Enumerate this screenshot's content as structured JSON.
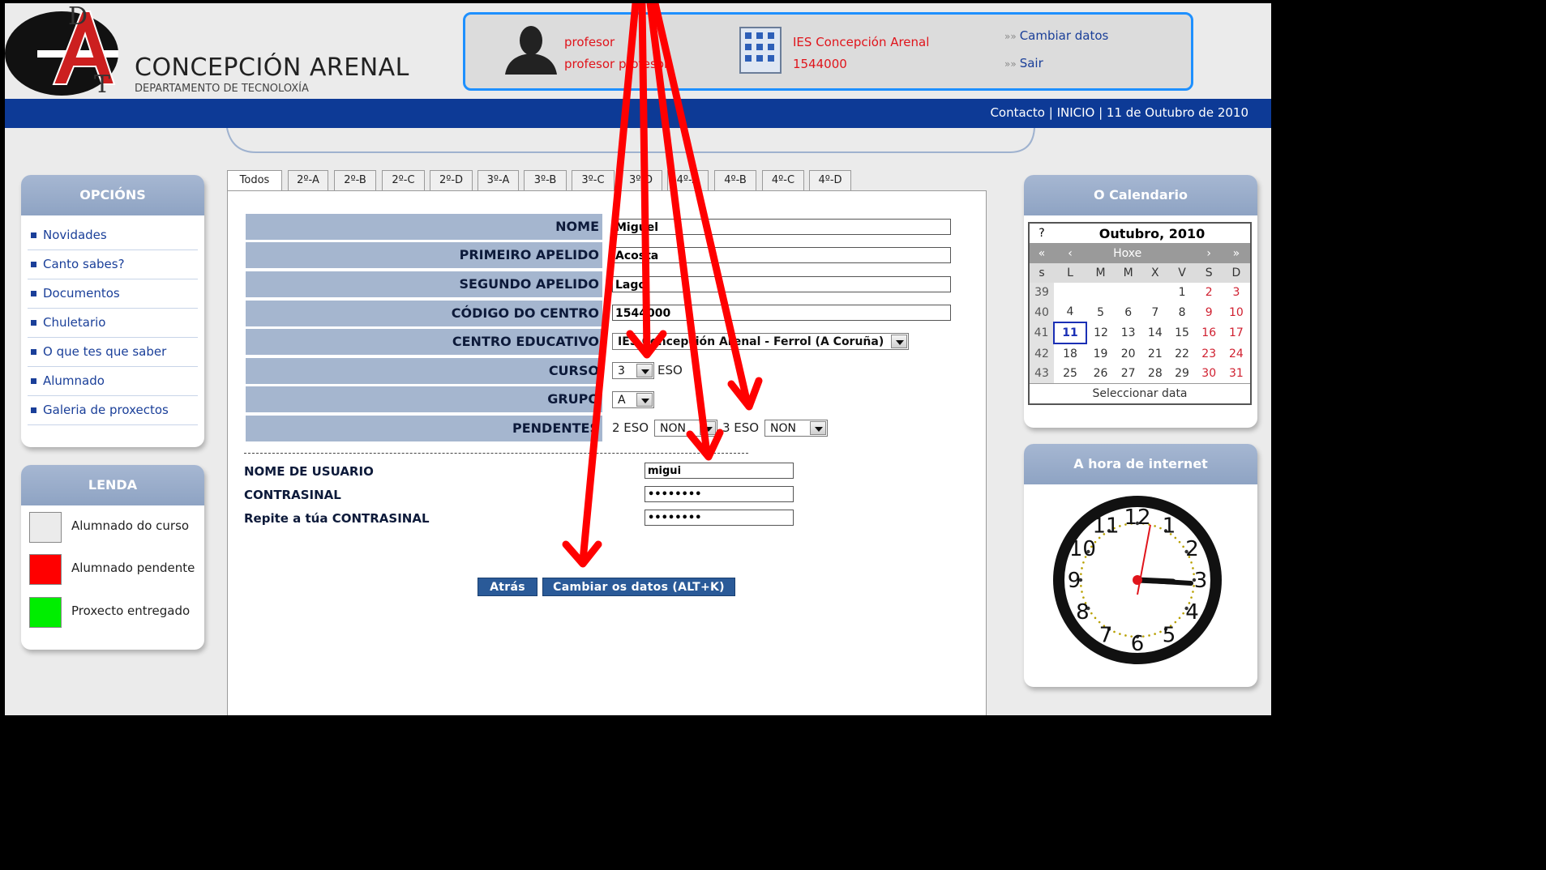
{
  "header": {
    "logo_letters": [
      "D",
      "A",
      "T"
    ],
    "title": "CONCEPCIÓN ARENAL",
    "subtitle": "DEPARTAMENTO DE TECNOLOXÍA"
  },
  "user": {
    "role": "profesor",
    "name": "profesor profesor",
    "school_name": "IES Concepción Arenal",
    "school_code": "1544000",
    "links": [
      {
        "label": "Cambiar datos"
      },
      {
        "label": "Sair"
      }
    ]
  },
  "navbar": {
    "text": "Contacto | INICIO | 11 de Outubro de 2010"
  },
  "sidebar": {
    "options_title": "OPCIÓNS",
    "items": [
      {
        "label": "Novidades"
      },
      {
        "label": "Canto sabes?"
      },
      {
        "label": "Documentos"
      },
      {
        "label": "Chuletario"
      },
      {
        "label": "O que tes que saber"
      },
      {
        "label": "Alumnado"
      },
      {
        "label": "Galeria de proxectos"
      }
    ],
    "legend_title": "LENDA",
    "legend": [
      {
        "label": "Alumnado do curso",
        "color": "#ebebeb"
      },
      {
        "label": "Alumnado pendente",
        "color": "#ff0000"
      },
      {
        "label": "Proxecto entregado",
        "color": "#00ee00"
      }
    ]
  },
  "tabs": [
    {
      "label": "Todos"
    },
    {
      "label": "2º-A"
    },
    {
      "label": "2º-B"
    },
    {
      "label": "2º-C"
    },
    {
      "label": "2º-D"
    },
    {
      "label": "3º-A"
    },
    {
      "label": "3º-B"
    },
    {
      "label": "3º-C"
    },
    {
      "label": "3º-D"
    },
    {
      "label": "4º-A"
    },
    {
      "label": "4º-B"
    },
    {
      "label": "4º-C"
    },
    {
      "label": "4º-D"
    }
  ],
  "form": {
    "nome": {
      "label": "NOME",
      "value": "Miguel"
    },
    "apelido1": {
      "label": "PRIMEIRO APELIDO",
      "value": "Acosta"
    },
    "apelido2": {
      "label": "SEGUNDO APELIDO",
      "value": "Lago"
    },
    "codigo": {
      "label": "CÓDIGO DO CENTRO",
      "value": "1544000"
    },
    "centro": {
      "label": "CENTRO EDUCATIVO",
      "value": "IES Concepción Arenal - Ferrol (A Coruña)"
    },
    "curso": {
      "label": "CURSO",
      "value": "3",
      "suffix": "ESO"
    },
    "grupo": {
      "label": "GRUPO",
      "value": "A"
    },
    "pendentes": {
      "label": "PENDENTES",
      "item1_label": "2 ESO",
      "item1_value": "NON",
      "item2_label": "3 ESO",
      "item2_value": "NON"
    },
    "usuario": {
      "label": "NOME DE USUARIO",
      "value": "migui"
    },
    "contrasinal": {
      "label": "CONTRASINAL",
      "value": "••••••••"
    },
    "repite": {
      "label": "Repite a túa CONTRASINAL",
      "value": "••••••••"
    },
    "back_button": "Atrás",
    "submit_button": "Cambiar os datos (ALT+K)"
  },
  "calendar": {
    "title": "O Calendario",
    "help": "?",
    "month_label": "Outubro, 2010",
    "nav_prev_year": "«",
    "nav_prev": "‹",
    "today_label": "Hoxe",
    "nav_next": "›",
    "nav_next_year": "»",
    "week_col": "s",
    "days": [
      "L",
      "M",
      "M",
      "X",
      "V",
      "S",
      "D"
    ],
    "weeks": [
      {
        "wk": "39",
        "d": [
          "",
          "",
          "",
          "",
          "1",
          "2",
          "3"
        ]
      },
      {
        "wk": "40",
        "d": [
          "4",
          "5",
          "6",
          "7",
          "8",
          "9",
          "10"
        ]
      },
      {
        "wk": "41",
        "d": [
          "11",
          "12",
          "13",
          "14",
          "15",
          "16",
          "17"
        ]
      },
      {
        "wk": "42",
        "d": [
          "18",
          "19",
          "20",
          "21",
          "22",
          "23",
          "24"
        ]
      },
      {
        "wk": "43",
        "d": [
          "25",
          "26",
          "27",
          "28",
          "29",
          "30",
          "31"
        ]
      }
    ],
    "today": "11",
    "footer": "Seleccionar data"
  },
  "clock": {
    "title": "A hora de internet",
    "numerals": [
      "12",
      "1",
      "2",
      "3",
      "4",
      "5",
      "6",
      "7",
      "8",
      "9",
      "10",
      "11"
    ]
  },
  "colors": {
    "navbar": "#0d3a96",
    "accent_red": "#e0141b",
    "link_blue": "#1a3f99",
    "annotation_arrow": "#ff0000"
  }
}
